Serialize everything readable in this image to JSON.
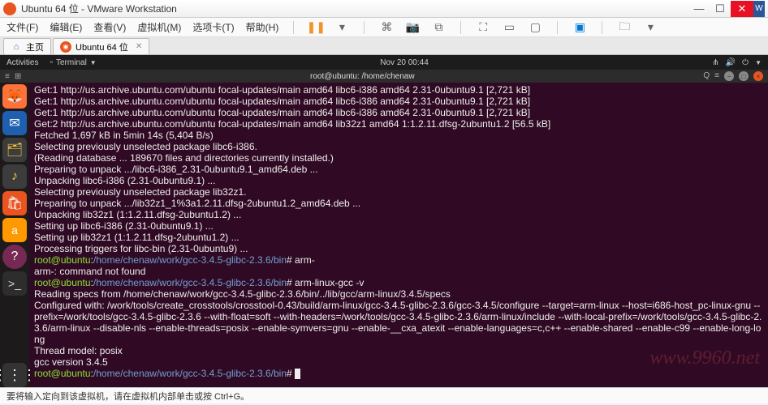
{
  "window": {
    "title": "Ubuntu 64 位 - VMware Workstation"
  },
  "menu": {
    "file": "文件(F)",
    "edit": "编辑(E)",
    "view": "查看(V)",
    "vm": "虚拟机(M)",
    "tabs": "选项卡(T)",
    "help": "帮助(H)"
  },
  "tabs": {
    "home": "主页",
    "ubuntu": "Ubuntu 64 位"
  },
  "gnome": {
    "activities": "Activities",
    "terminal": "Terminal",
    "datetime": "Nov 20  00:44"
  },
  "termtitle": "root@ubuntu: /home/chenaw",
  "lines": [
    "Get:1 http://us.archive.ubuntu.com/ubuntu focal-updates/main amd64 libc6-i386 amd64 2.31-0ubuntu9.1 [2,721 kB]",
    "Get:1 http://us.archive.ubuntu.com/ubuntu focal-updates/main amd64 libc6-i386 amd64 2.31-0ubuntu9.1 [2,721 kB]",
    "Get:1 http://us.archive.ubuntu.com/ubuntu focal-updates/main amd64 libc6-i386 amd64 2.31-0ubuntu9.1 [2,721 kB]",
    "Get:2 http://us.archive.ubuntu.com/ubuntu focal-updates/main amd64 lib32z1 amd64 1:1.2.11.dfsg-2ubuntu1.2 [56.5 kB]",
    "Fetched 1,697 kB in 5min 14s (5,404 B/s)",
    "Selecting previously unselected package libc6-i386.",
    "(Reading database ... 189670 files and directories currently installed.)",
    "Preparing to unpack .../libc6-i386_2.31-0ubuntu9.1_amd64.deb ...",
    "Unpacking libc6-i386 (2.31-0ubuntu9.1) ...",
    "Selecting previously unselected package lib32z1.",
    "Preparing to unpack .../lib32z1_1%3a1.2.11.dfsg-2ubuntu1.2_amd64.deb ...",
    "Unpacking lib32z1 (1:1.2.11.dfsg-2ubuntu1.2) ...",
    "Setting up libc6-i386 (2.31-0ubuntu9.1) ...",
    "Setting up lib32z1 (1:1.2.11.dfsg-2ubuntu1.2) ...",
    "Processing triggers for libc-bin (2.31-0ubuntu9) ..."
  ],
  "prompt1": {
    "user": "root@ubuntu",
    "path": "/home/chenaw/work/gcc-3.4.5-glibc-2.3.6/bin",
    "cmd": "arm-"
  },
  "err": "arm-: command not found",
  "prompt2": {
    "user": "root@ubuntu",
    "path": "/home/chenaw/work/gcc-3.4.5-glibc-2.3.6/bin",
    "cmd": "arm-linux-gcc -v"
  },
  "gccout": [
    "Reading specs from /home/chenaw/work/gcc-3.4.5-glibc-2.3.6/bin/../lib/gcc/arm-linux/3.4.5/specs",
    "Configured with: /work/tools/create_crosstools/crosstool-0.43/build/arm-linux/gcc-3.4.5-glibc-2.3.6/gcc-3.4.5/configure --target=arm-linux --host=i686-host_pc-linux-gnu --prefix=/work/tools/gcc-3.4.5-glibc-2.3.6 --with-float=soft --with-headers=/work/tools/gcc-3.4.5-glibc-2.3.6/arm-linux/include --with-local-prefix=/work/tools/gcc-3.4.5-glibc-2.3.6/arm-linux --disable-nls --enable-threads=posix --enable-symvers=gnu --enable-__cxa_atexit --enable-languages=c,c++ --enable-shared --enable-c99 --enable-long-long",
    "Thread model: posix",
    "gcc version 3.4.5"
  ],
  "prompt3": {
    "user": "root@ubuntu",
    "path": "/home/chenaw/work/gcc-3.4.5-glibc-2.3.6/bin"
  },
  "status": "要将输入定向到该虚拟机，请在虚拟机内部单击或按 Ctrl+G。",
  "watermark": "www.9960.net"
}
